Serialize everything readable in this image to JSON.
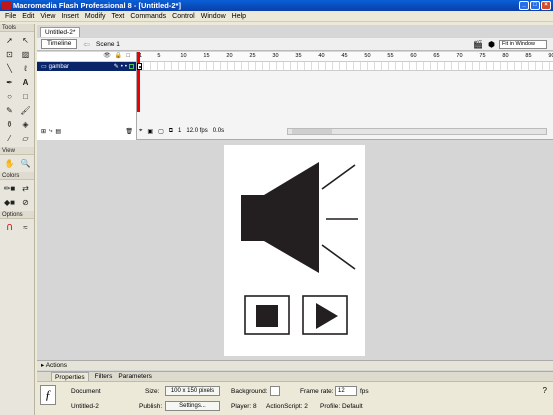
{
  "window": {
    "title": "Macromedia Flash Professional 8 - [Untitled-2*]"
  },
  "menu": [
    "File",
    "Edit",
    "View",
    "Insert",
    "Modify",
    "Text",
    "Commands",
    "Control",
    "Window",
    "Help"
  ],
  "tools": {
    "header": "Tools",
    "view_header": "View",
    "colors_header": "Colors",
    "options_header": "Options"
  },
  "document": {
    "tab": "Untitled-2*",
    "timeline_btn": "Timeline",
    "scene": "Scene 1",
    "zoom": "Fit in Window"
  },
  "timeline": {
    "layer_name": "gambar",
    "ruler": [
      "1",
      "5",
      "10",
      "15",
      "20",
      "25",
      "30",
      "35",
      "40",
      "45",
      "50",
      "55",
      "60",
      "65",
      "70",
      "75",
      "80",
      "85",
      "90"
    ],
    "current_frame": "1",
    "fps": "12.0 fps",
    "time": "0.0s"
  },
  "panels": {
    "actions": "Actions"
  },
  "props": {
    "tabs": [
      "Properties",
      "Filters",
      "Parameters"
    ],
    "doc_label": "Document",
    "doc_name": "Untitled-2",
    "size_label": "Size:",
    "size_value": "100 x 150 pixels",
    "publish_label": "Publish:",
    "settings_btn": "Settings...",
    "bg_label": "Background:",
    "fr_label": "Frame rate:",
    "fr_value": "12",
    "fps_unit": "fps",
    "player_text": "Player: 8",
    "as_text": "ActionScript: 2",
    "profile_text": "Profile: Default"
  },
  "colors": {
    "title_bar": "#0b4fc8",
    "stage": "#ffffff",
    "workspace": "#d6d6d6",
    "shape_fill": "#231f20"
  }
}
